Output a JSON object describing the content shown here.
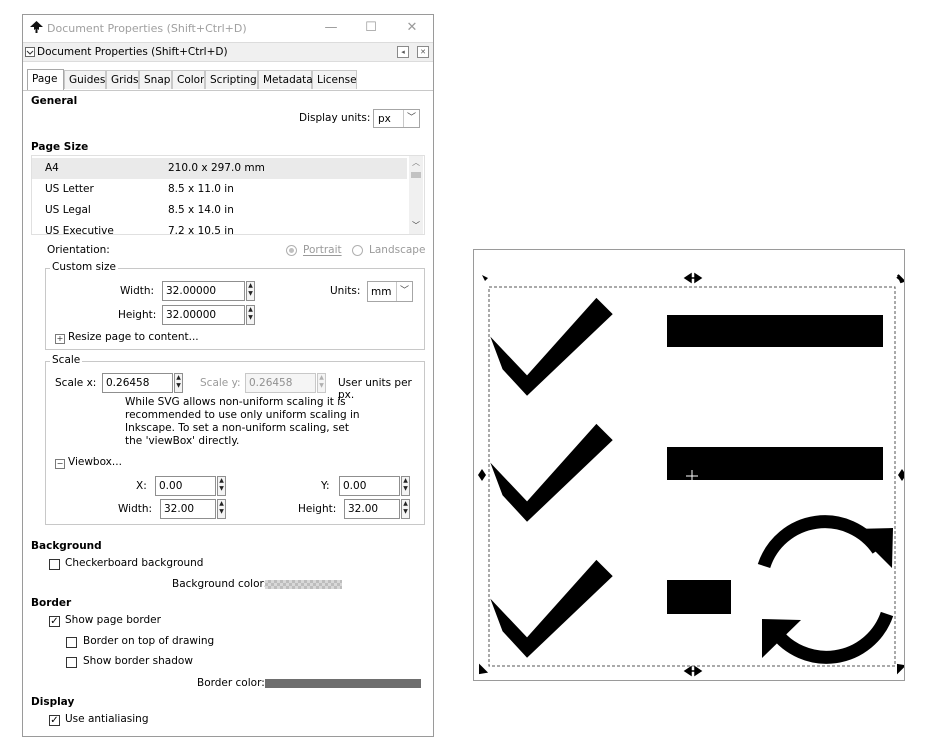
{
  "window": {
    "title": "Document Properties (Shift+Ctrl+D)",
    "minimize": "—",
    "maximize": "☐",
    "close": "✕"
  },
  "dock": {
    "title": "Document Properties (Shift+Ctrl+D)"
  },
  "tabs": [
    "Page",
    "Guides",
    "Grids",
    "Snap",
    "Color",
    "Scripting",
    "Metadata",
    "License"
  ],
  "general": {
    "heading": "General",
    "display_units_label": "Display units:",
    "display_units_value": "px"
  },
  "page_size": {
    "heading": "Page Size",
    "rows": [
      {
        "name": "A4",
        "size": "210.0 x 297.0 mm"
      },
      {
        "name": "US Letter",
        "size": "8.5 x 11.0 in"
      },
      {
        "name": "US Legal",
        "size": "8.5 x 14.0 in"
      },
      {
        "name": "US Executive",
        "size": "7.2 x 10.5 in"
      }
    ],
    "orientation_label": "Orientation:",
    "portrait": "Portrait",
    "landscape": "Landscape"
  },
  "custom_size": {
    "legend": "Custom size",
    "width_label": "Width:",
    "width_value": "32.00000",
    "height_label": "Height:",
    "height_value": "32.00000",
    "units_label": "Units:",
    "units_value": "mm",
    "resize_label": "Resize page to content..."
  },
  "scale": {
    "legend": "Scale",
    "scale_x_label": "Scale x:",
    "scale_x_value": "0.26458",
    "scale_y_label": "Scale y:",
    "scale_y_value": "0.26458",
    "user_units": "User units per px.",
    "note": "While SVG allows non-uniform scaling it is recommended to use only uniform scaling in Inkscape. To set a non-uniform scaling, set the 'viewBox' directly.",
    "viewbox_label": "Viewbox...",
    "x_label": "X:",
    "x_value": "0.00",
    "y_label": "Y:",
    "y_value": "0.00",
    "width_label": "Width:",
    "width_value": "32.00",
    "height_label": "Height:",
    "height_value": "32.00"
  },
  "background": {
    "heading": "Background",
    "checkerboard_label": "Checkerboard background",
    "checkerboard_checked": false,
    "color_label": "Background color:"
  },
  "border": {
    "heading": "Border",
    "show_border_label": "Show page border",
    "show_border_checked": true,
    "on_top_label": "Border on top of drawing",
    "on_top_checked": false,
    "shadow_label": "Show border shadow",
    "shadow_checked": false,
    "color_label": "Border color:",
    "color": "#6e6e6e"
  },
  "display": {
    "heading": "Display",
    "antialias_label": "Use antialiasing",
    "antialias_checked": true
  },
  "canvas": {
    "icon_color": "#000000",
    "bbox_color": "#555555"
  }
}
